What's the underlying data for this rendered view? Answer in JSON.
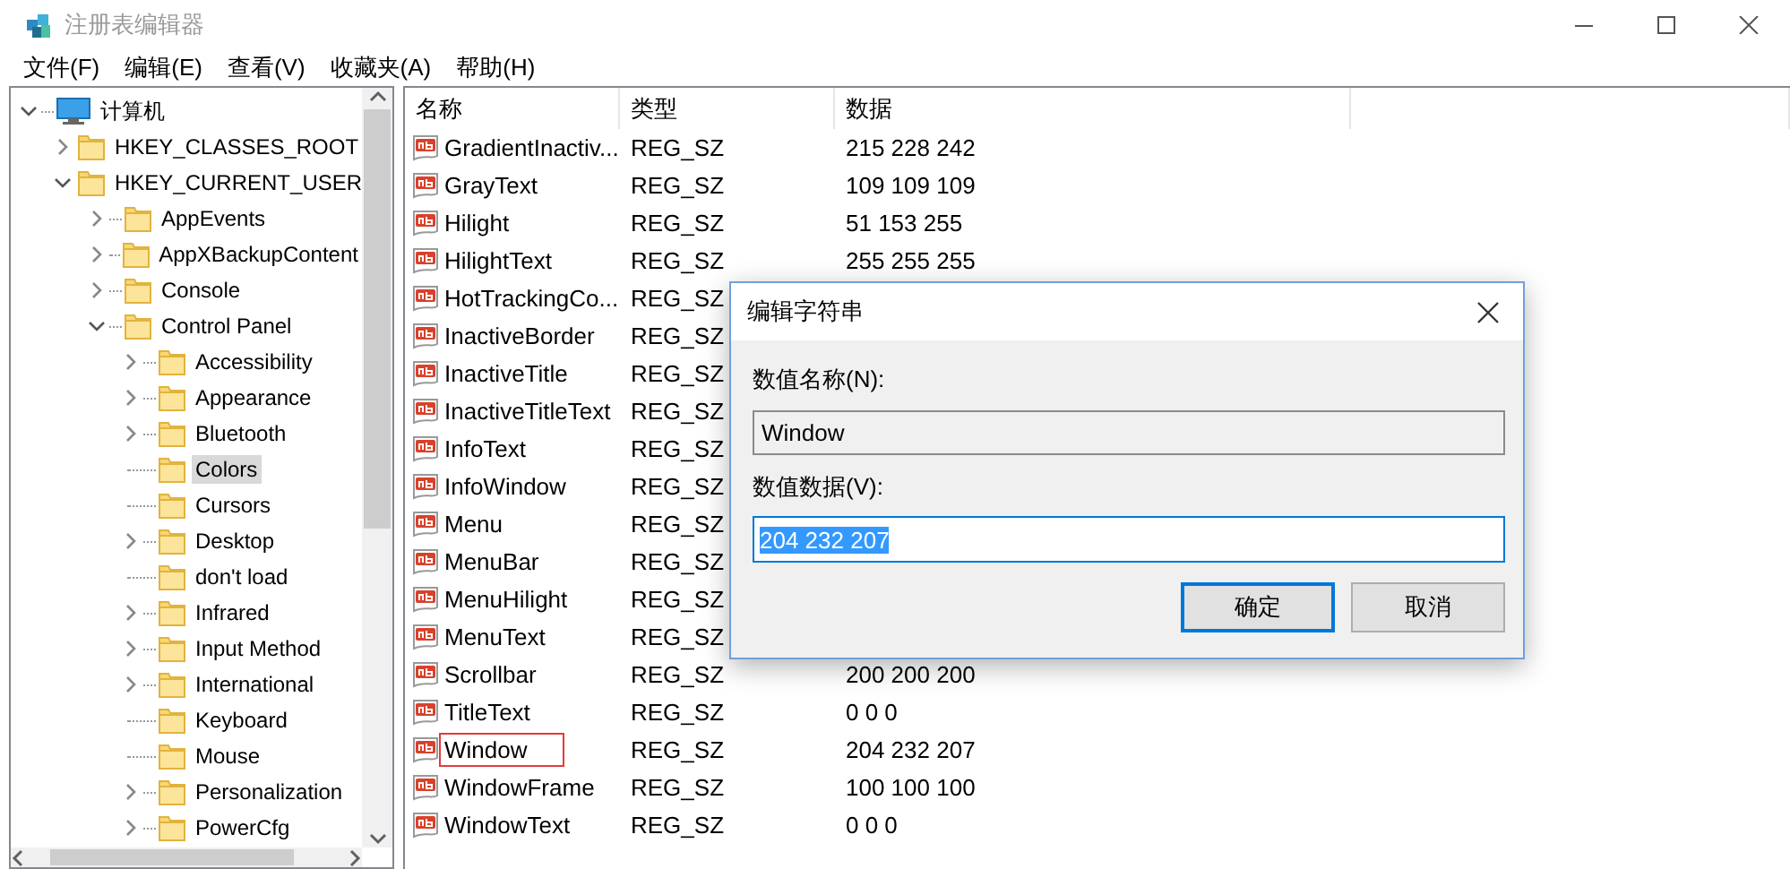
{
  "window": {
    "title": "注册表编辑器"
  },
  "menu": [
    "文件(F)",
    "编辑(E)",
    "查看(V)",
    "收藏夹(A)",
    "帮助(H)"
  ],
  "tree": [
    {
      "label": "计算机",
      "kind": "computer",
      "expanded": true,
      "selected": false,
      "children": [
        {
          "label": "HKEY_CLASSES_ROOT",
          "expanded": false,
          "selected": false
        },
        {
          "label": "HKEY_CURRENT_USER",
          "expanded": true,
          "selected": false,
          "children": [
            {
              "label": "AppEvents",
              "expanded": false,
              "selected": false
            },
            {
              "label": "AppXBackupContent",
              "expanded": false,
              "selected": false
            },
            {
              "label": "Console",
              "expanded": false,
              "selected": false
            },
            {
              "label": "Control Panel",
              "expanded": true,
              "selected": false,
              "children": [
                {
                  "label": "Accessibility",
                  "expanded": false,
                  "selected": false
                },
                {
                  "label": "Appearance",
                  "expanded": false,
                  "selected": false
                },
                {
                  "label": "Bluetooth",
                  "expanded": false,
                  "selected": false
                },
                {
                  "label": "Colors",
                  "selected": true
                },
                {
                  "label": "Cursors",
                  "selected": false
                },
                {
                  "label": "Desktop",
                  "expanded": false,
                  "selected": false
                },
                {
                  "label": "don't load",
                  "selected": false
                },
                {
                  "label": "Infrared",
                  "expanded": false,
                  "selected": false
                },
                {
                  "label": "Input Method",
                  "expanded": false,
                  "selected": false
                },
                {
                  "label": "International",
                  "expanded": false,
                  "selected": false
                },
                {
                  "label": "Keyboard",
                  "selected": false
                },
                {
                  "label": "Mouse",
                  "selected": false
                },
                {
                  "label": "Personalization",
                  "expanded": false,
                  "selected": false
                },
                {
                  "label": "PowerCfg",
                  "expanded": false,
                  "selected": false
                }
              ]
            }
          ]
        }
      ]
    }
  ],
  "table": {
    "columns": [
      "名称",
      "类型",
      "数据"
    ],
    "rows": [
      {
        "name": "GradientInactiv...",
        "type": "REG_SZ",
        "data": "215 228 242",
        "outlined": false
      },
      {
        "name": "GrayText",
        "type": "REG_SZ",
        "data": "109 109 109",
        "outlined": false
      },
      {
        "name": "Hilight",
        "type": "REG_SZ",
        "data": "51 153 255",
        "outlined": false
      },
      {
        "name": "HilightText",
        "type": "REG_SZ",
        "data": "255 255 255",
        "outlined": false
      },
      {
        "name": "HotTrackingCo...",
        "type": "REG_SZ",
        "outlined": false
      },
      {
        "name": "InactiveBorder",
        "type": "REG_SZ",
        "outlined": false
      },
      {
        "name": "InactiveTitle",
        "type": "REG_SZ",
        "outlined": false
      },
      {
        "name": "InactiveTitleText",
        "type": "REG_SZ",
        "outlined": false
      },
      {
        "name": "InfoText",
        "type": "REG_SZ",
        "outlined": false
      },
      {
        "name": "InfoWindow",
        "type": "REG_SZ",
        "outlined": false
      },
      {
        "name": "Menu",
        "type": "REG_SZ",
        "outlined": false
      },
      {
        "name": "MenuBar",
        "type": "REG_SZ",
        "outlined": false
      },
      {
        "name": "MenuHilight",
        "type": "REG_SZ",
        "outlined": false
      },
      {
        "name": "MenuText",
        "type": "REG_SZ",
        "outlined": false
      },
      {
        "name": "Scrollbar",
        "type": "REG_SZ",
        "data": "200 200 200",
        "outlined": false
      },
      {
        "name": "TitleText",
        "type": "REG_SZ",
        "data": "0 0 0",
        "outlined": false
      },
      {
        "name": "Window",
        "type": "REG_SZ",
        "data": "204 232 207",
        "outlined": true
      },
      {
        "name": "WindowFrame",
        "type": "REG_SZ",
        "data": "100 100 100",
        "outlined": false
      },
      {
        "name": "WindowText",
        "type": "REG_SZ",
        "data": "0 0 0",
        "outlined": false
      }
    ]
  },
  "dialog": {
    "title": "编辑字符串",
    "name_label": "数值名称(N):",
    "name_value": "Window",
    "data_label": "数值数据(V):",
    "data_value": "204 232 207",
    "data_selected": true,
    "buttons": [
      {
        "label": "确定",
        "default": true
      },
      {
        "label": "取消",
        "default": false
      }
    ]
  }
}
